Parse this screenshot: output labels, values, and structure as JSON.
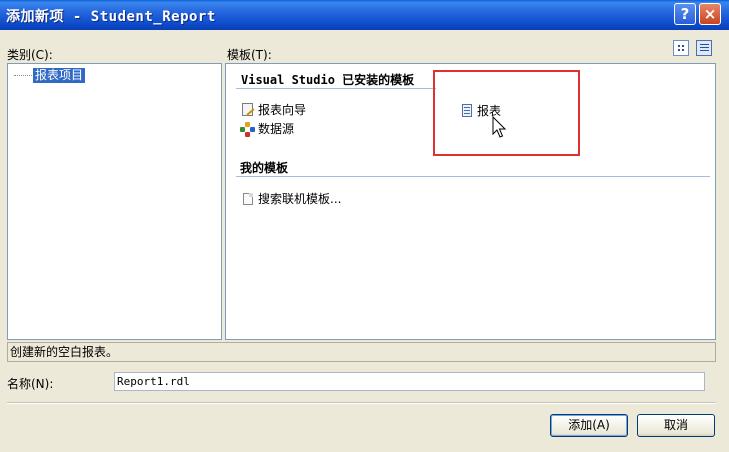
{
  "window": {
    "title": "添加新项 - Student_Report",
    "help_glyph": "?",
    "close_glyph": "×"
  },
  "category": {
    "label": "类别(C):",
    "items": [
      {
        "label": "报表项目",
        "selected": true
      }
    ]
  },
  "templates": {
    "label": "模板(T):",
    "view_large_icon": "large-icons-view-icon",
    "view_small_icon": "small-icons-view-icon",
    "installed_header": "Visual Studio 已安装的模板",
    "installed_items": [
      {
        "label": "报表向导",
        "icon": "report-wizard-icon"
      },
      {
        "label": "数据源",
        "icon": "data-source-icon"
      },
      {
        "label": "报表",
        "icon": "report-icon"
      }
    ],
    "my_header": "我的模板",
    "my_items": [
      {
        "label": "搜索联机模板...",
        "icon": "search-online-icon"
      }
    ]
  },
  "status_text": "创建新的空白报表。",
  "name_field": {
    "label": "名称(N):",
    "value": "Report1.rdl"
  },
  "buttons": {
    "add": "添加(A)",
    "cancel": "取消"
  },
  "colors": {
    "titlebar": "#2566de",
    "selection": "#316ac5",
    "highlight_box": "#e03030"
  }
}
